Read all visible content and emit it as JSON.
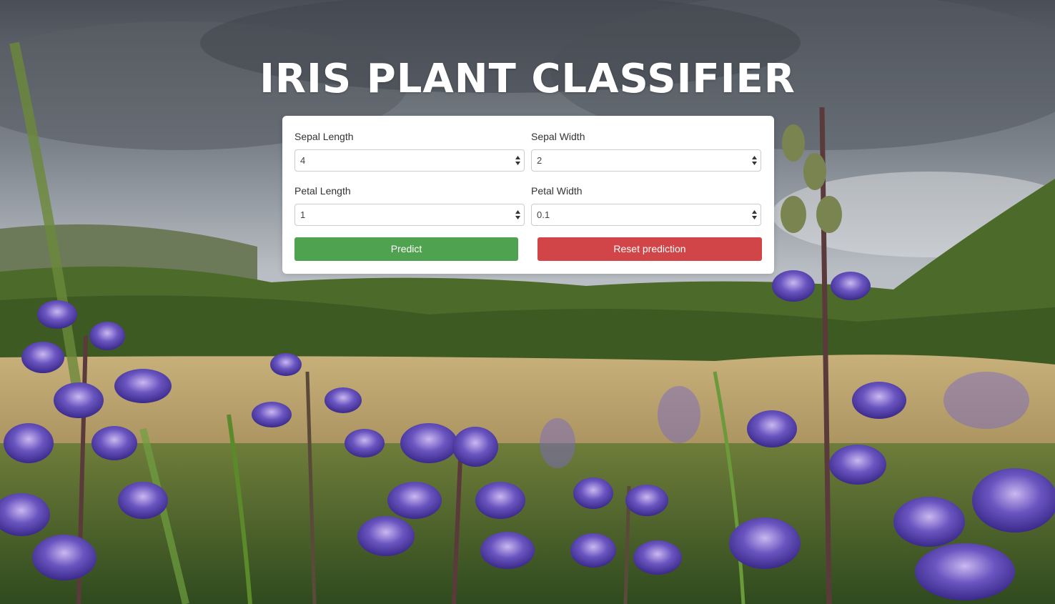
{
  "page": {
    "title": "IRIS PLANT CLASSIFIER"
  },
  "form": {
    "fields": [
      {
        "label": "Sepal Length",
        "value": "4"
      },
      {
        "label": "Sepal Width",
        "value": "2"
      },
      {
        "label": "Petal Length",
        "value": "1"
      },
      {
        "label": "Petal Width",
        "value": "0.1"
      }
    ],
    "predict_label": "Predict",
    "reset_label": "Reset prediction"
  },
  "colors": {
    "predict_button": "#4fa350",
    "reset_button": "#d14548",
    "card_background": "#ffffff",
    "title_text": "#ffffff"
  },
  "icons": {
    "select_spinner": "spinner-arrows-icon"
  }
}
